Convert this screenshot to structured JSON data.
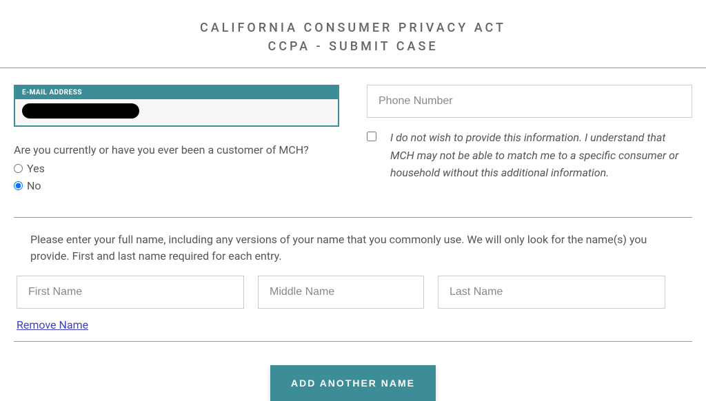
{
  "header": {
    "title": "CALIFORNIA CONSUMER PRIVACY ACT",
    "subtitle": "CCPA - SUBMIT CASE"
  },
  "email": {
    "label": "E-MAIL ADDRESS",
    "value_redacted": true
  },
  "phone": {
    "placeholder": "Phone Number",
    "value": ""
  },
  "customer_question": {
    "text": "Are you currently or have you ever been a customer of MCH?",
    "options": {
      "yes": "Yes",
      "no": "No"
    },
    "selected": "no"
  },
  "no_info_checkbox": {
    "checked": false,
    "text": "I do not wish to provide this information. I understand that MCH may not be able to match me to a specific consumer or household without this additional information."
  },
  "name_section": {
    "instructions": "Please enter your full name, including any versions of your name that you commonly use. We will only look for the name(s) you provide. First and last name required for each entry.",
    "first_placeholder": "First Name",
    "middle_placeholder": "Middle Name",
    "last_placeholder": "Last Name",
    "first_value": "",
    "middle_value": "",
    "last_value": "",
    "remove_label": "Remove Name"
  },
  "add_button": {
    "label": "ADD ANOTHER NAME"
  }
}
